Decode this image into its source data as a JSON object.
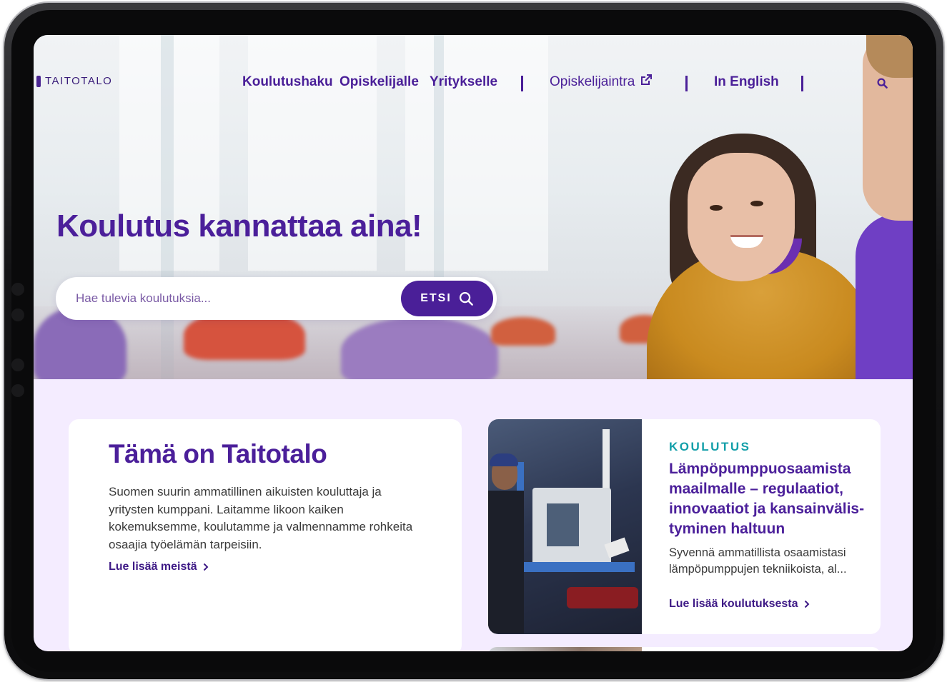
{
  "header": {
    "logo_text": "TAITOTALO",
    "nav": {
      "koulutushaku": "Koulutushaku",
      "opiskelijalle": "Opiskelijalle",
      "yritykselle": "Yritykselle",
      "opiskelijaintra": "Opiskelijaintra",
      "in_english": "In English"
    }
  },
  "hero": {
    "title": "Koulutus kannattaa aina!",
    "search": {
      "placeholder": "Hae tulevia koulutuksia...",
      "button_label": "ETSI"
    }
  },
  "intro_card": {
    "title": "Tämä on Taitotalo",
    "body": "Suomen suurin ammatillinen aikuisten kouluttaja ja yritysten kumppani. Laitamme likoon kaiken kokemuksemme, koulutamme ja valmennamme rohkeita osaajia työelämän tarpeisiin.",
    "link_label": "Lue lisää meistä"
  },
  "feature_card": {
    "tag": "KOULUTUS",
    "title": "Lämpöpumppuosaamista maailmalle – regulaatiot, innovaatiot ja kansainvälis-tyminen haltuun",
    "excerpt": "Syvennä ammatillista osaamistasi lämpöpumppujen tekniikoista, al...",
    "link_label": "Lue lisää koulutuksesta"
  },
  "colors": {
    "brand_purple": "#4a1f98",
    "accent_teal": "#139fa9",
    "content_background": "#f4ecff"
  }
}
